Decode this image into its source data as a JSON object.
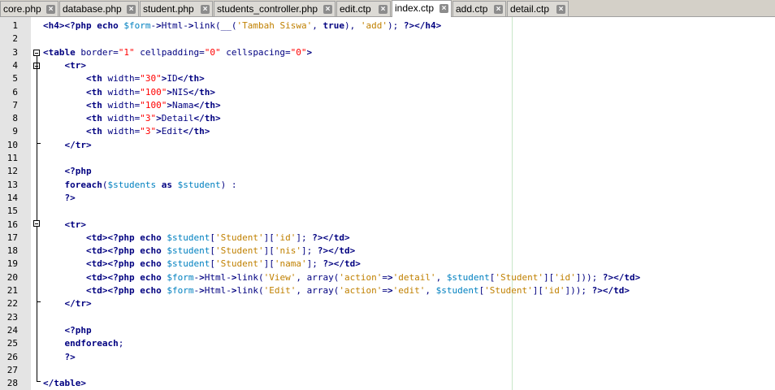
{
  "tabs": [
    {
      "label": "core.php",
      "active": false
    },
    {
      "label": "database.php",
      "active": false
    },
    {
      "label": "student.php",
      "active": false
    },
    {
      "label": "students_controller.php",
      "active": false
    },
    {
      "label": "edit.ctp",
      "active": false
    },
    {
      "label": "index.ctp",
      "active": true
    },
    {
      "label": "add.ctp",
      "active": false
    },
    {
      "label": "detail.ctp",
      "active": false
    }
  ],
  "code_lines": [
    {
      "n": "1",
      "text": "<h4><?php echo $form->Html->link(__('Tambah Siswa', true), 'add'); ?></h4>"
    },
    {
      "n": "2",
      "text": ""
    },
    {
      "n": "3",
      "text": "<table border=\"1\" cellpadding=\"0\" cellspacing=\"0\">"
    },
    {
      "n": "4",
      "text": "    <tr>"
    },
    {
      "n": "5",
      "text": "        <th width=\"30\">ID</th>"
    },
    {
      "n": "6",
      "text": "        <th width=\"100\">NIS</th>"
    },
    {
      "n": "7",
      "text": "        <th width=\"100\">Nama</th>"
    },
    {
      "n": "8",
      "text": "        <th width=\"3\">Detail</th>"
    },
    {
      "n": "9",
      "text": "        <th width=\"3\">Edit</th>"
    },
    {
      "n": "10",
      "text": "    </tr>"
    },
    {
      "n": "11",
      "text": ""
    },
    {
      "n": "12",
      "text": "    <?php"
    },
    {
      "n": "13",
      "text": "    foreach($students as $student) :"
    },
    {
      "n": "14",
      "text": "    ?>"
    },
    {
      "n": "15",
      "text": ""
    },
    {
      "n": "16",
      "text": "    <tr>"
    },
    {
      "n": "17",
      "text": "        <td><?php echo $student['Student']['id']; ?></td>"
    },
    {
      "n": "18",
      "text": "        <td><?php echo $student['Student']['nis']; ?></td>"
    },
    {
      "n": "19",
      "text": "        <td><?php echo $student['Student']['nama']; ?></td>"
    },
    {
      "n": "20",
      "text": "        <td><?php echo $form->Html->link('View', array('action'=>'detail', $student['Student']['id'])); ?></td>"
    },
    {
      "n": "21",
      "text": "        <td><?php echo $form->Html->link('Edit', array('action'=>'edit', $student['Student']['id'])); ?></td>"
    },
    {
      "n": "22",
      "text": "    </tr>"
    },
    {
      "n": "23",
      "text": ""
    },
    {
      "n": "24",
      "text": "    <?php"
    },
    {
      "n": "25",
      "text": "    endforeach;"
    },
    {
      "n": "26",
      "text": "    ?>"
    },
    {
      "n": "27",
      "text": ""
    },
    {
      "n": "28",
      "text": "</table>"
    }
  ],
  "colors": {
    "tag": "#000080",
    "variable": "#0080c0",
    "string": "#c08000",
    "attr_value": "#ff0000",
    "gutter_bg": "#e4e4e4",
    "tabbar_bg": "#d4d0c8"
  },
  "icons": {
    "tab_close": "close-x-icon",
    "fold_open": "fold-minus-icon"
  }
}
